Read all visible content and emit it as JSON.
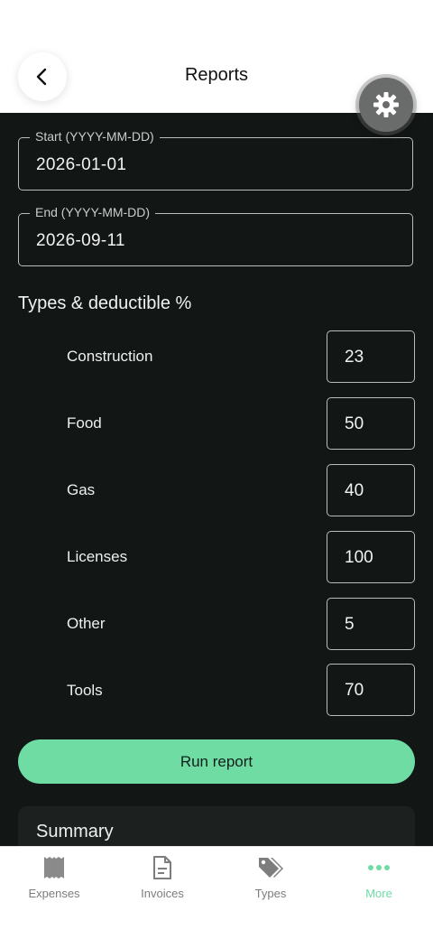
{
  "header": {
    "title": "Reports"
  },
  "form": {
    "start": {
      "label": "Start (YYYY-MM-DD)",
      "value": "2026-01-01"
    },
    "end": {
      "label": "End (YYYY-MM-DD)",
      "value": "2026-09-11"
    }
  },
  "types_section": {
    "title": "Types & deductible %",
    "rows": [
      {
        "label": "Construction",
        "value": "23"
      },
      {
        "label": "Food",
        "value": "50"
      },
      {
        "label": "Gas",
        "value": "40"
      },
      {
        "label": "Licenses",
        "value": "100"
      },
      {
        "label": "Other",
        "value": "5"
      },
      {
        "label": "Tools",
        "value": "70"
      }
    ]
  },
  "run_button": {
    "label": "Run report"
  },
  "summary": {
    "title": "Summary"
  },
  "tabs": [
    {
      "label": "Expenses",
      "icon": "receipt-icon"
    },
    {
      "label": "Invoices",
      "icon": "document-icon"
    },
    {
      "label": "Types",
      "icon": "tags-icon"
    },
    {
      "label": "More",
      "icon": "more-dots-icon",
      "active": true
    }
  ],
  "colors": {
    "accent": "#6fdca4",
    "background": "#121614"
  }
}
